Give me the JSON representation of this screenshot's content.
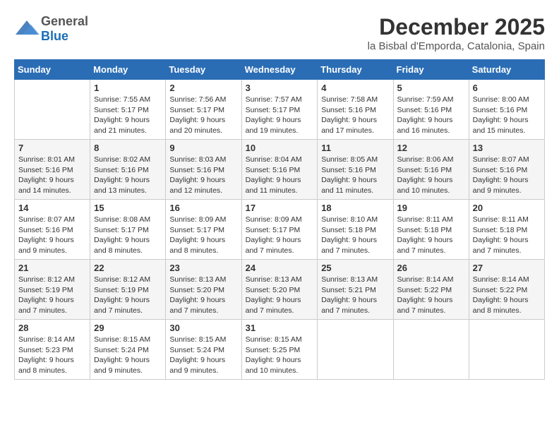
{
  "logo": {
    "general": "General",
    "blue": "Blue"
  },
  "header": {
    "month": "December 2025",
    "location": "la Bisbal d'Emporda, Catalonia, Spain"
  },
  "weekdays": [
    "Sunday",
    "Monday",
    "Tuesday",
    "Wednesday",
    "Thursday",
    "Friday",
    "Saturday"
  ],
  "weeks": [
    [
      {
        "day": "",
        "sunrise": "",
        "sunset": "",
        "daylight": ""
      },
      {
        "day": "1",
        "sunrise": "Sunrise: 7:55 AM",
        "sunset": "Sunset: 5:17 PM",
        "daylight": "Daylight: 9 hours and 21 minutes."
      },
      {
        "day": "2",
        "sunrise": "Sunrise: 7:56 AM",
        "sunset": "Sunset: 5:17 PM",
        "daylight": "Daylight: 9 hours and 20 minutes."
      },
      {
        "day": "3",
        "sunrise": "Sunrise: 7:57 AM",
        "sunset": "Sunset: 5:17 PM",
        "daylight": "Daylight: 9 hours and 19 minutes."
      },
      {
        "day": "4",
        "sunrise": "Sunrise: 7:58 AM",
        "sunset": "Sunset: 5:16 PM",
        "daylight": "Daylight: 9 hours and 17 minutes."
      },
      {
        "day": "5",
        "sunrise": "Sunrise: 7:59 AM",
        "sunset": "Sunset: 5:16 PM",
        "daylight": "Daylight: 9 hours and 16 minutes."
      },
      {
        "day": "6",
        "sunrise": "Sunrise: 8:00 AM",
        "sunset": "Sunset: 5:16 PM",
        "daylight": "Daylight: 9 hours and 15 minutes."
      }
    ],
    [
      {
        "day": "7",
        "sunrise": "Sunrise: 8:01 AM",
        "sunset": "Sunset: 5:16 PM",
        "daylight": "Daylight: 9 hours and 14 minutes."
      },
      {
        "day": "8",
        "sunrise": "Sunrise: 8:02 AM",
        "sunset": "Sunset: 5:16 PM",
        "daylight": "Daylight: 9 hours and 13 minutes."
      },
      {
        "day": "9",
        "sunrise": "Sunrise: 8:03 AM",
        "sunset": "Sunset: 5:16 PM",
        "daylight": "Daylight: 9 hours and 12 minutes."
      },
      {
        "day": "10",
        "sunrise": "Sunrise: 8:04 AM",
        "sunset": "Sunset: 5:16 PM",
        "daylight": "Daylight: 9 hours and 11 minutes."
      },
      {
        "day": "11",
        "sunrise": "Sunrise: 8:05 AM",
        "sunset": "Sunset: 5:16 PM",
        "daylight": "Daylight: 9 hours and 11 minutes."
      },
      {
        "day": "12",
        "sunrise": "Sunrise: 8:06 AM",
        "sunset": "Sunset: 5:16 PM",
        "daylight": "Daylight: 9 hours and 10 minutes."
      },
      {
        "day": "13",
        "sunrise": "Sunrise: 8:07 AM",
        "sunset": "Sunset: 5:16 PM",
        "daylight": "Daylight: 9 hours and 9 minutes."
      }
    ],
    [
      {
        "day": "14",
        "sunrise": "Sunrise: 8:07 AM",
        "sunset": "Sunset: 5:16 PM",
        "daylight": "Daylight: 9 hours and 9 minutes."
      },
      {
        "day": "15",
        "sunrise": "Sunrise: 8:08 AM",
        "sunset": "Sunset: 5:17 PM",
        "daylight": "Daylight: 9 hours and 8 minutes."
      },
      {
        "day": "16",
        "sunrise": "Sunrise: 8:09 AM",
        "sunset": "Sunset: 5:17 PM",
        "daylight": "Daylight: 9 hours and 8 minutes."
      },
      {
        "day": "17",
        "sunrise": "Sunrise: 8:09 AM",
        "sunset": "Sunset: 5:17 PM",
        "daylight": "Daylight: 9 hours and 7 minutes."
      },
      {
        "day": "18",
        "sunrise": "Sunrise: 8:10 AM",
        "sunset": "Sunset: 5:18 PM",
        "daylight": "Daylight: 9 hours and 7 minutes."
      },
      {
        "day": "19",
        "sunrise": "Sunrise: 8:11 AM",
        "sunset": "Sunset: 5:18 PM",
        "daylight": "Daylight: 9 hours and 7 minutes."
      },
      {
        "day": "20",
        "sunrise": "Sunrise: 8:11 AM",
        "sunset": "Sunset: 5:18 PM",
        "daylight": "Daylight: 9 hours and 7 minutes."
      }
    ],
    [
      {
        "day": "21",
        "sunrise": "Sunrise: 8:12 AM",
        "sunset": "Sunset: 5:19 PM",
        "daylight": "Daylight: 9 hours and 7 minutes."
      },
      {
        "day": "22",
        "sunrise": "Sunrise: 8:12 AM",
        "sunset": "Sunset: 5:19 PM",
        "daylight": "Daylight: 9 hours and 7 minutes."
      },
      {
        "day": "23",
        "sunrise": "Sunrise: 8:13 AM",
        "sunset": "Sunset: 5:20 PM",
        "daylight": "Daylight: 9 hours and 7 minutes."
      },
      {
        "day": "24",
        "sunrise": "Sunrise: 8:13 AM",
        "sunset": "Sunset: 5:20 PM",
        "daylight": "Daylight: 9 hours and 7 minutes."
      },
      {
        "day": "25",
        "sunrise": "Sunrise: 8:13 AM",
        "sunset": "Sunset: 5:21 PM",
        "daylight": "Daylight: 9 hours and 7 minutes."
      },
      {
        "day": "26",
        "sunrise": "Sunrise: 8:14 AM",
        "sunset": "Sunset: 5:22 PM",
        "daylight": "Daylight: 9 hours and 7 minutes."
      },
      {
        "day": "27",
        "sunrise": "Sunrise: 8:14 AM",
        "sunset": "Sunset: 5:22 PM",
        "daylight": "Daylight: 9 hours and 8 minutes."
      }
    ],
    [
      {
        "day": "28",
        "sunrise": "Sunrise: 8:14 AM",
        "sunset": "Sunset: 5:23 PM",
        "daylight": "Daylight: 9 hours and 8 minutes."
      },
      {
        "day": "29",
        "sunrise": "Sunrise: 8:15 AM",
        "sunset": "Sunset: 5:24 PM",
        "daylight": "Daylight: 9 hours and 9 minutes."
      },
      {
        "day": "30",
        "sunrise": "Sunrise: 8:15 AM",
        "sunset": "Sunset: 5:24 PM",
        "daylight": "Daylight: 9 hours and 9 minutes."
      },
      {
        "day": "31",
        "sunrise": "Sunrise: 8:15 AM",
        "sunset": "Sunset: 5:25 PM",
        "daylight": "Daylight: 9 hours and 10 minutes."
      },
      {
        "day": "",
        "sunrise": "",
        "sunset": "",
        "daylight": ""
      },
      {
        "day": "",
        "sunrise": "",
        "sunset": "",
        "daylight": ""
      },
      {
        "day": "",
        "sunrise": "",
        "sunset": "",
        "daylight": ""
      }
    ]
  ]
}
